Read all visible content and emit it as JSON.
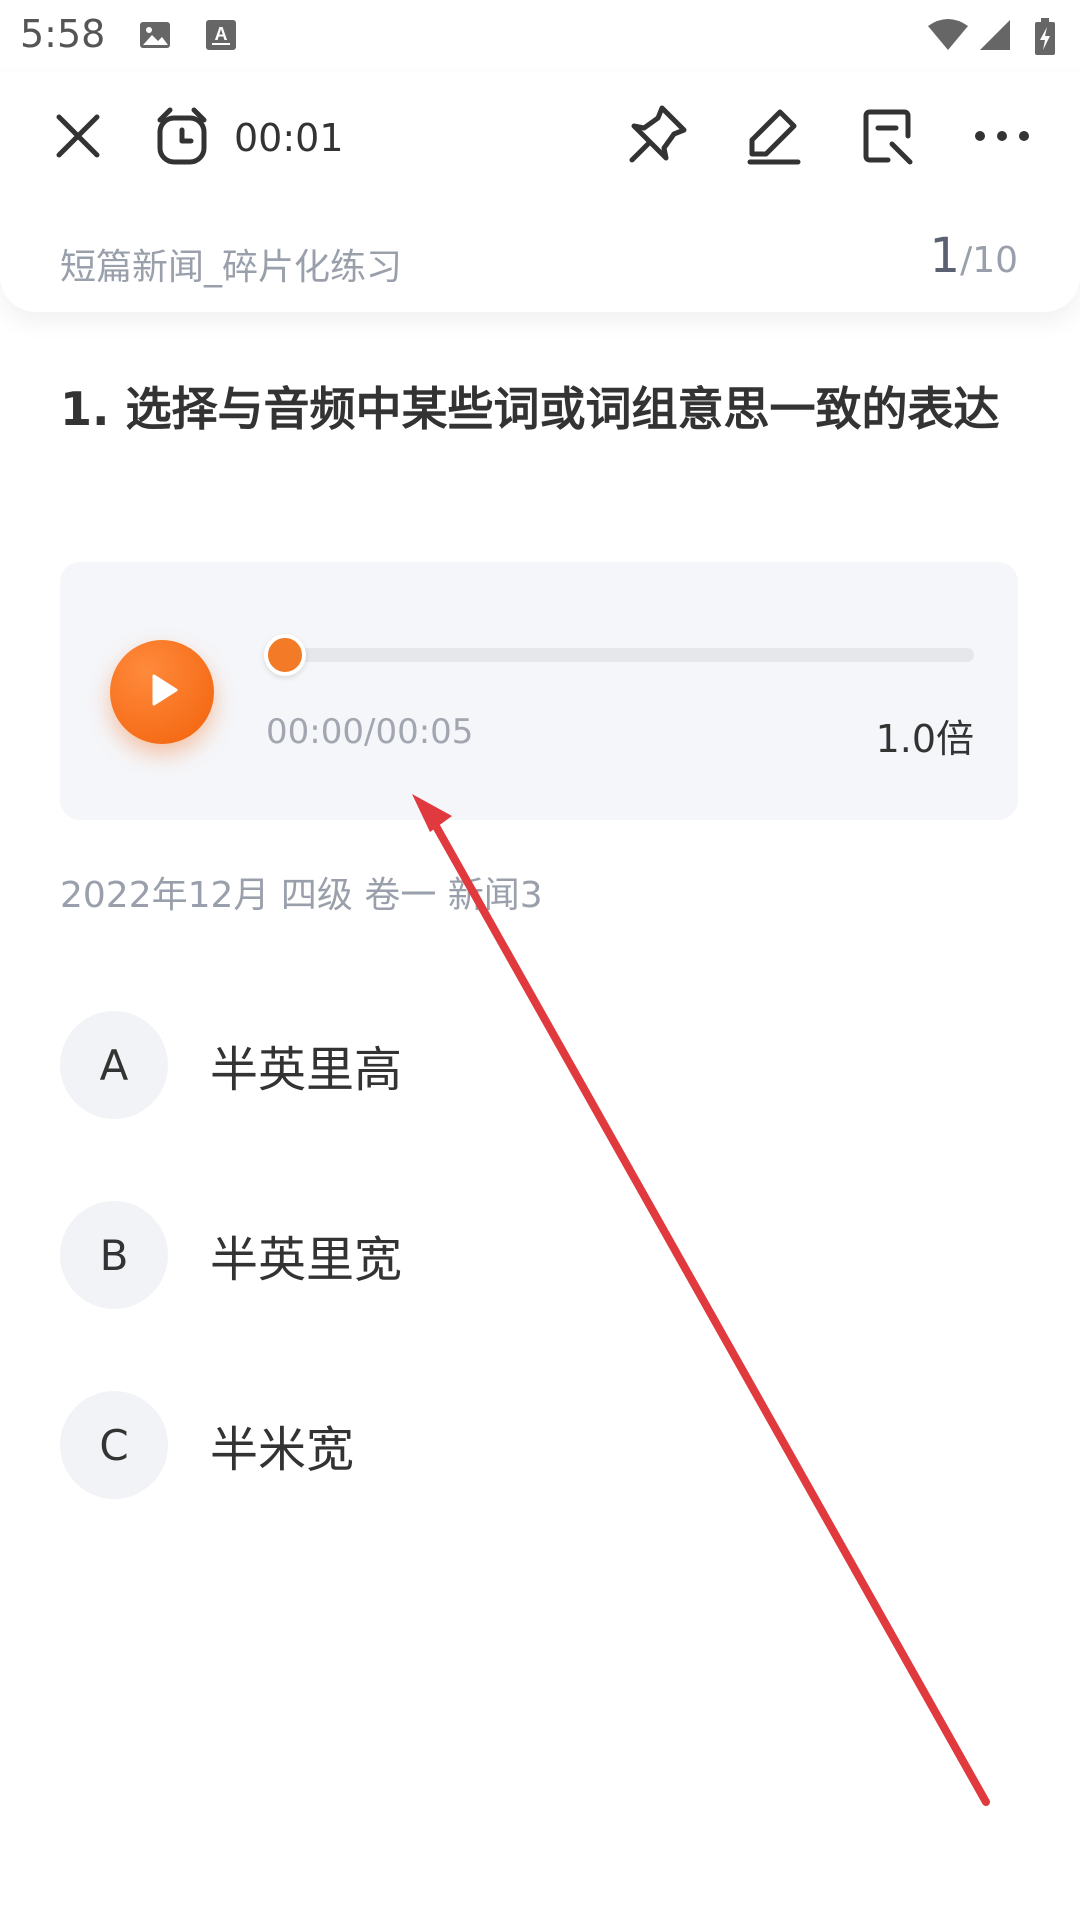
{
  "status_bar": {
    "time": "5:58",
    "icons": [
      "image-icon",
      "keyboard-a-icon",
      "wifi-icon",
      "signal-icon",
      "battery-charging-icon"
    ]
  },
  "toolbar": {
    "timer": "00:01",
    "icons": [
      "close-icon",
      "alarm-clock-icon",
      "pin-icon",
      "edit-icon",
      "answer-sheet-icon",
      "more-icon"
    ]
  },
  "header": {
    "practice_title": "短篇新闻_碎片化练习",
    "page_current": "1",
    "page_total": "/10"
  },
  "question": {
    "title": "1. 选择与音频中某些词或词组意思一致的表达",
    "source": "2022年12月 四级 卷一 新闻3"
  },
  "audio": {
    "time": "00:00/00:05",
    "speed": "1.0倍",
    "progress": 0.0,
    "accent_color": "#f37a26"
  },
  "options": [
    {
      "letter": "A",
      "text": "半英里高"
    },
    {
      "letter": "B",
      "text": "半英里宽"
    },
    {
      "letter": "C",
      "text": "半米宽"
    }
  ],
  "annotation": {
    "type": "arrow",
    "color": "#e0393e"
  }
}
